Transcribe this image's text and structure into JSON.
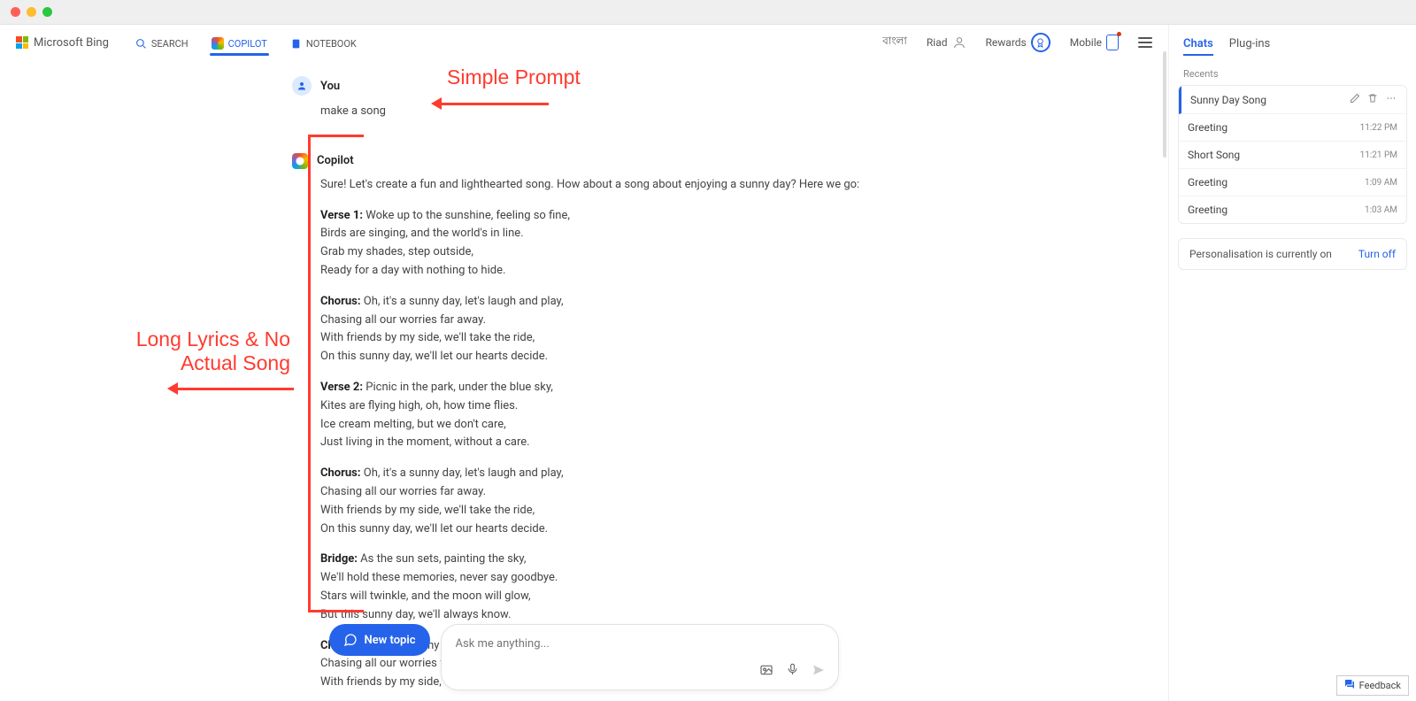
{
  "brand": "Microsoft Bing",
  "nav": {
    "search": "SEARCH",
    "copilot": "COPILOT",
    "notebook": "NOTEBOOK"
  },
  "nav_right": {
    "lang": "বাংলা",
    "user": "Riad",
    "rewards": "Rewards",
    "mobile": "Mobile"
  },
  "conversation": {
    "user_label": "You",
    "user_msg": "make a song",
    "copilot_label": "Copilot",
    "intro": "Sure! Let's create a fun and lighthearted song. How about a song about enjoying a sunny day? Here we go:",
    "sections": [
      {
        "label": "Verse 1:",
        "lines": [
          "Woke up to the sunshine, feeling so fine,",
          "Birds are singing, and the world's in line.",
          "Grab my shades, step outside,",
          "Ready for a day with nothing to hide."
        ]
      },
      {
        "label": "Chorus:",
        "lines": [
          "Oh, it's a sunny day, let's laugh and play,",
          "Chasing all our worries far away.",
          "With friends by my side, we'll take the ride,",
          "On this sunny day, we'll let our hearts decide."
        ]
      },
      {
        "label": "Verse 2:",
        "lines": [
          "Picnic in the park, under the blue sky,",
          "Kites are flying high, oh, how time flies.",
          "Ice cream melting, but we don't care,",
          "Just living in the moment, without a care."
        ]
      },
      {
        "label": "Chorus:",
        "lines": [
          "Oh, it's a sunny day, let's laugh and play,",
          "Chasing all our worries far away.",
          "With friends by my side, we'll take the ride,",
          "On this sunny day, we'll let our hearts decide."
        ]
      },
      {
        "label": "Bridge:",
        "lines": [
          "As the sun sets, painting the sky,",
          "We'll hold these memories, never say goodbye.",
          "Stars will twinkle, and the moon will glow,",
          "But this sunny day, we'll always know."
        ]
      },
      {
        "label": "Chorus:",
        "lines": [
          "Oh, it's a sunny day, let's laugh and play,",
          "Chasing all our worries far away.",
          "With friends by my side, we'll take the ride,"
        ]
      }
    ]
  },
  "annotations": {
    "a1": "Simple Prompt",
    "a2": "Long Lyrics & No\nActual Song"
  },
  "input": {
    "new_topic": "New topic",
    "placeholder": "Ask me anything..."
  },
  "right": {
    "tab_chats": "Chats",
    "tab_plugins": "Plug-ins",
    "recents_label": "Recents",
    "items": [
      {
        "title": "Sunny Day Song",
        "time": "",
        "active": true
      },
      {
        "title": "Greeting",
        "time": "11:22 PM"
      },
      {
        "title": "Short Song",
        "time": "11:21 PM"
      },
      {
        "title": "Greeting",
        "time": "1:09 AM"
      },
      {
        "title": "Greeting",
        "time": "1:03 AM"
      }
    ],
    "pers_text": "Personalisation is currently on",
    "pers_action": "Turn off"
  },
  "feedback": "Feedback"
}
